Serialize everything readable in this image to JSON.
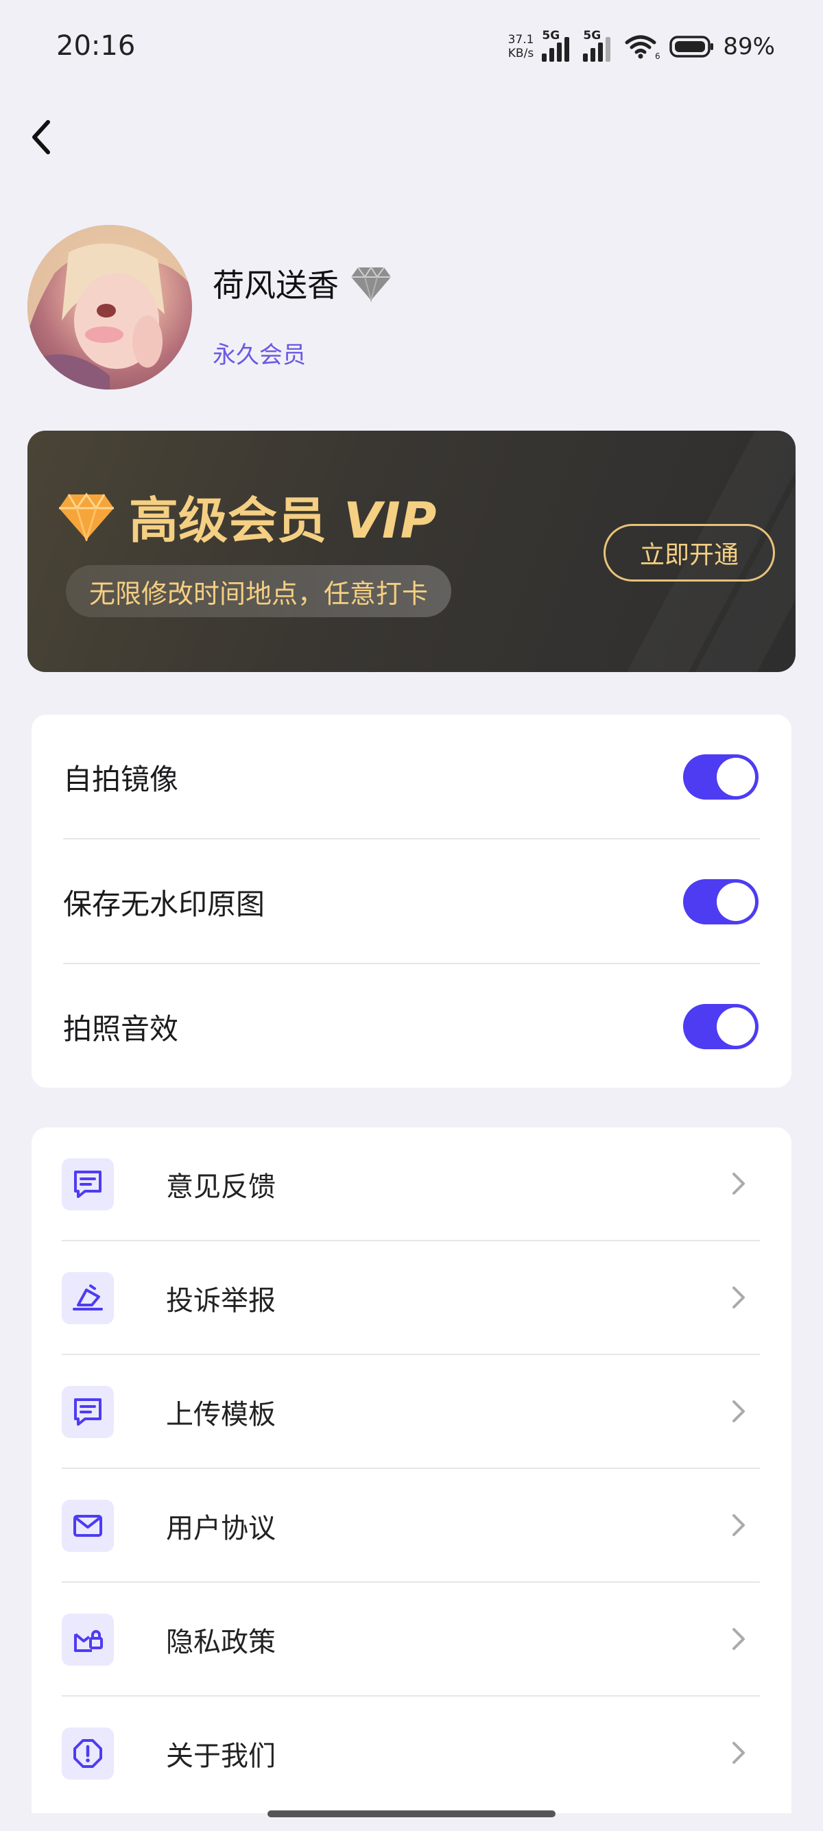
{
  "status_bar": {
    "time": "20:16",
    "net_speed_value": "37.1",
    "net_speed_unit": "KB/s",
    "signal1_label": "5G",
    "signal2_label": "5G",
    "wifi_label": "6",
    "battery": "89%"
  },
  "profile": {
    "username": "荷风送香",
    "member_status": "永久会员"
  },
  "vip": {
    "title_cn": "高级会员",
    "title_en": "VIP",
    "subtitle": "无限修改时间地点，任意打卡",
    "button_label": "立即开通",
    "gold_color": "#f5cf82"
  },
  "toggles": [
    {
      "label": "自拍镜像",
      "on": true
    },
    {
      "label": "保存无水印原图",
      "on": true
    },
    {
      "label": "拍照音效",
      "on": true
    }
  ],
  "menu": [
    {
      "label": "意见反馈",
      "icon": "message-icon"
    },
    {
      "label": "投诉举报",
      "icon": "report-icon"
    },
    {
      "label": "上传模板",
      "icon": "message-icon"
    },
    {
      "label": "用户协议",
      "icon": "mail-icon"
    },
    {
      "label": "隐私政策",
      "icon": "privacy-icon"
    },
    {
      "label": "关于我们",
      "icon": "info-icon"
    }
  ],
  "colors": {
    "accent": "#4d3cf2",
    "background": "#f1f0f7",
    "member_text": "#6a5ae0"
  }
}
